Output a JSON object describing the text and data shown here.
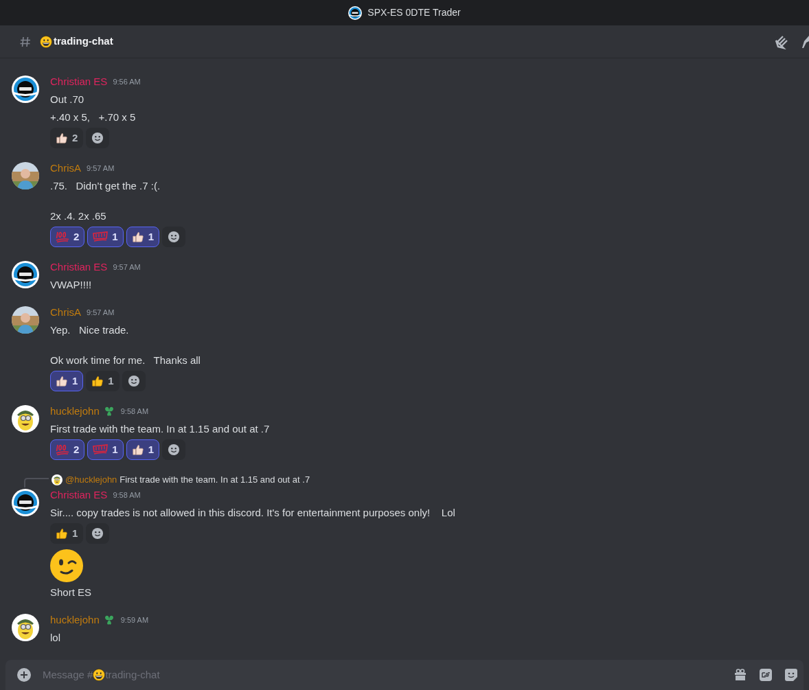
{
  "window": {
    "title": "SPX-ES 0DTE Trader"
  },
  "channel": {
    "name": "trading-chat"
  },
  "messages": [
    {
      "author": "Christian ES",
      "color": "#e0245e",
      "avatar": {
        "kind": "logo"
      },
      "time": "9:56 AM",
      "blocks": [
        {
          "kind": "text",
          "text": "Out .70"
        },
        {
          "kind": "text",
          "text": "+.40 x 5,   +.70 x 5"
        },
        {
          "kind": "reactions",
          "items": [
            {
              "kind": "thumbs-light",
              "count": "2",
              "selected": false
            }
          ]
        }
      ]
    },
    {
      "author": "ChrisA",
      "color": "#c27c0e",
      "time": "9:57 AM",
      "blocks": [
        {
          "kind": "text",
          "text": ".75.   Didn’t get the .7 :(."
        },
        {
          "kind": "break"
        },
        {
          "kind": "text",
          "text": "2x .4. 2x .65"
        },
        {
          "kind": "reactions",
          "items": [
            {
              "kind": "hundred",
              "count": "2",
              "selected": true
            },
            {
              "kind": "noice",
              "count": "1",
              "selected": true
            },
            {
              "kind": "thumbs-light",
              "count": "1",
              "selected": true
            }
          ]
        }
      ]
    },
    {
      "author": "Christian ES",
      "color": "#e0245e",
      "avatar": {
        "kind": "logo"
      },
      "time": "9:57 AM",
      "blocks": [
        {
          "kind": "text",
          "text": "VWAP!!!!"
        }
      ]
    },
    {
      "author": "ChrisA",
      "color": "#c27c0e",
      "time": "9:57 AM",
      "blocks": [
        {
          "kind": "text",
          "text": "Yep.   Nice trade."
        },
        {
          "kind": "break"
        },
        {
          "kind": "text",
          "text": "Ok work time for me.   Thanks all"
        },
        {
          "kind": "reactions",
          "items": [
            {
              "kind": "thumbs-light",
              "count": "1",
              "selected": true
            },
            {
              "kind": "thumbs-yellow",
              "count": "1",
              "selected": false
            }
          ]
        }
      ]
    },
    {
      "author": "hucklejohn",
      "color": "#c27c0e",
      "avatar": {
        "kind": "cartoon"
      },
      "badge": true,
      "time": "9:58 AM",
      "blocks": [
        {
          "kind": "text",
          "text": "First trade with the team. In at 1.15 and out at .7"
        },
        {
          "kind": "reactions",
          "items": [
            {
              "kind": "hundred",
              "count": "2",
              "selected": true
            },
            {
              "kind": "noice",
              "count": "1",
              "selected": true
            },
            {
              "kind": "thumbs-light",
              "count": "1",
              "selected": true
            }
          ]
        }
      ]
    },
    {
      "author": "Christian ES",
      "color": "#e0245e",
      "avatar": {
        "kind": "logo"
      },
      "time": "9:58 AM",
      "reply": {
        "avatar": {
          "kind": "cartoon"
        },
        "mention": "@hucklejohn",
        "text": "First trade with the team. In at 1.15 and out at .7"
      },
      "blocks": [
        {
          "kind": "text",
          "text": "Sir.... copy trades is not allowed in this discord. It's for entertainment purposes only!    Lol"
        },
        {
          "kind": "reactions",
          "items": [
            {
              "kind": "thumbs-yellow",
              "count": "1",
              "selected": false
            }
          ]
        },
        {
          "kind": "wink"
        },
        {
          "kind": "text",
          "text": "Short ES"
        }
      ]
    },
    {
      "author": "hucklejohn",
      "color": "#c27c0e",
      "avatar": {
        "kind": "cartoon"
      },
      "badge": true,
      "time": "9:59 AM",
      "blocks": [
        {
          "kind": "text",
          "text": "lol"
        }
      ]
    }
  ],
  "composer": {
    "placeholder_prefix": "Message #",
    "placeholder_channel": "trading-chat"
  }
}
